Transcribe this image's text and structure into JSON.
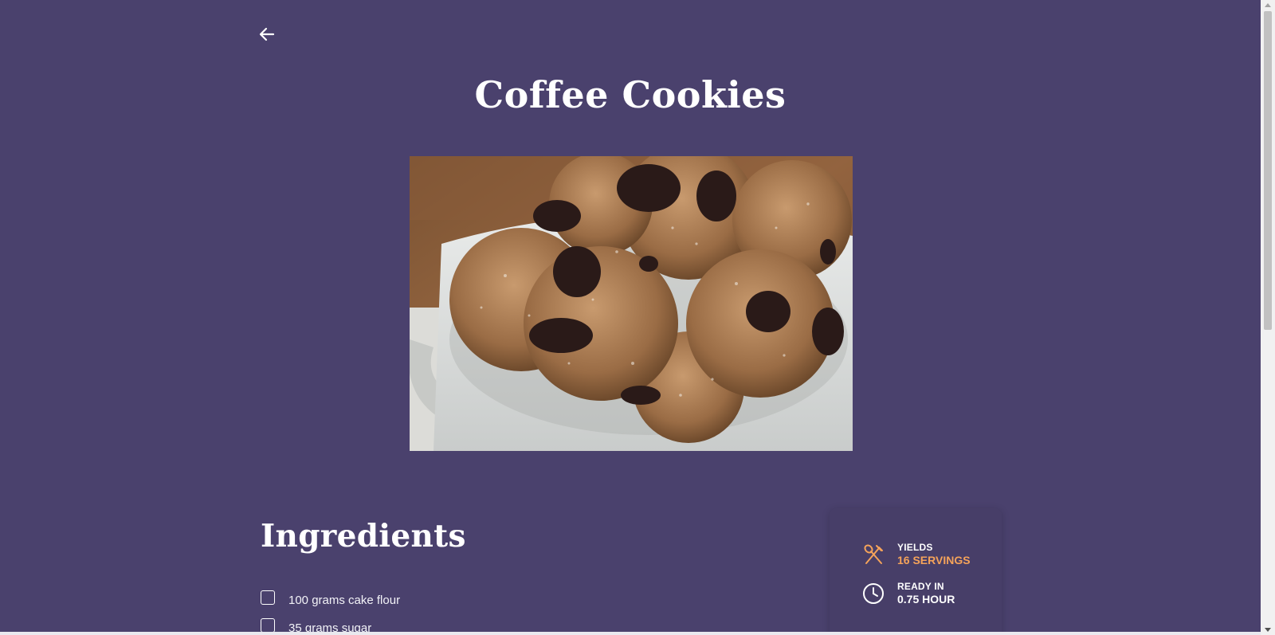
{
  "recipe": {
    "title": "Coffee Cookies",
    "image_alt": "Coffee cookies dusted with sugar in a white mug"
  },
  "nav": {
    "back_icon": "arrow-left-icon"
  },
  "ingredients": {
    "heading": "Ingredients",
    "items": [
      {
        "label": "100 grams cake flour",
        "checked": false
      },
      {
        "label": "35 grams sugar",
        "checked": false
      }
    ]
  },
  "info": {
    "yields_label": "YIELDS",
    "yields_value": "16 SERVINGS",
    "yields_icon": "fork-spoon-icon",
    "ready_label": "READY IN",
    "ready_value": "0.75 HOUR",
    "ready_icon": "clock-icon"
  },
  "colors": {
    "background": "#4a416d",
    "accent": "#f5a35a",
    "text": "#ffffff"
  }
}
